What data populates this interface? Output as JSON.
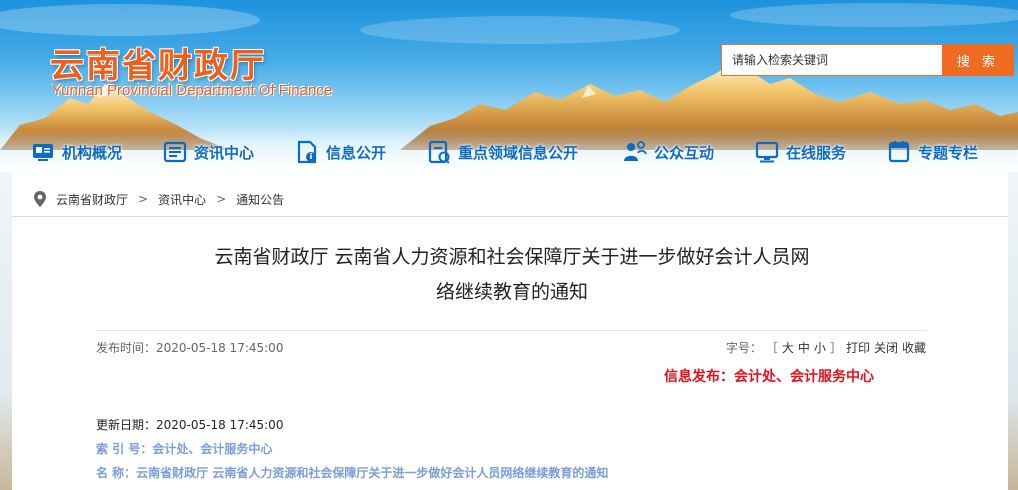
{
  "header": {
    "logo_cn": "云南省财政厅",
    "logo_en": "Yunnan Provincial Department Of Finance",
    "search": {
      "placeholder": "请输入检索关键词",
      "button_label": "搜 索"
    }
  },
  "nav": {
    "items": [
      {
        "label": "机构概况",
        "icon": "org-overview-icon"
      },
      {
        "label": "资讯中心",
        "icon": "news-center-icon"
      },
      {
        "label": "信息公开",
        "icon": "info-disclosure-icon"
      },
      {
        "label": "重点领域信息公开",
        "icon": "key-areas-icon"
      },
      {
        "label": "公众互动",
        "icon": "public-interaction-icon"
      },
      {
        "label": "在线服务",
        "icon": "online-service-icon"
      },
      {
        "label": "专题专栏",
        "icon": "special-topics-icon"
      }
    ]
  },
  "breadcrumb": {
    "items": [
      "云南省财政厅",
      "资讯中心",
      "通知公告"
    ],
    "separator": ">"
  },
  "article": {
    "title_line1": "云南省财政厅 云南省人力资源和社会保障厅关于进一步做好会计人员网",
    "title_line2": "络继续教育的通知",
    "publish_time": "发布时间：2020-05-18 17:45:00",
    "font_tools": {
      "label": "字号：",
      "open": "［",
      "large": "大",
      "medium": "中",
      "small": "小",
      "close": "］",
      "print": "打印",
      "close_window": "关闭",
      "favorite": "收藏"
    },
    "issuer": "信息发布：会计处、会计服务中心",
    "update_date": "更新日期：2020-05-18 17:45:00",
    "index_no": "索 引 号：会计处、会计服务中心",
    "name": "名  称：云南省财政厅 云南省人力资源和社会保障厅关于进一步做好会计人员网络继续教育的通知"
  },
  "colors": {
    "brand_orange": "#ef5f1c",
    "nav_blue": "#0c6bc4",
    "issuer_red": "#e8101a",
    "meta_blue": "#7a9ddc"
  }
}
